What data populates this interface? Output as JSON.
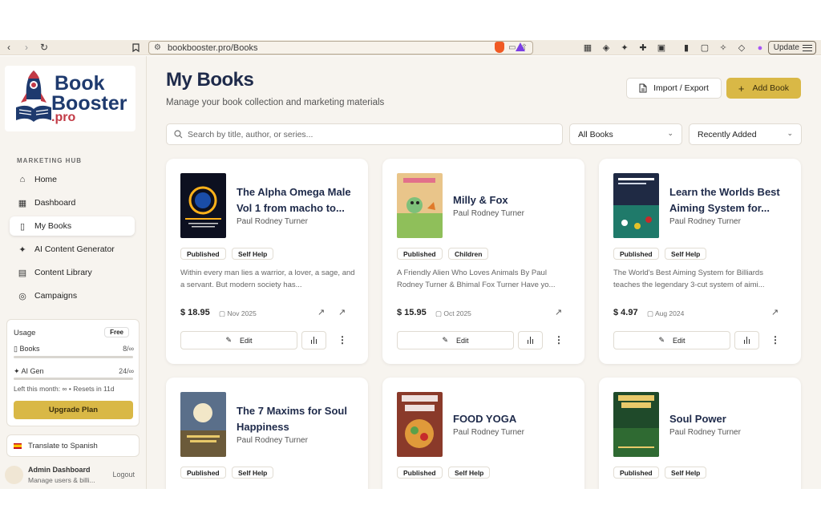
{
  "browser": {
    "url": "bookbooster.pro/Books",
    "update_label": "Update"
  },
  "sidebar": {
    "logo_line1": "Book",
    "logo_line2": "Booster",
    "logo_suffix": ".pro",
    "section_label": "MARKETING HUB",
    "items": [
      {
        "label": "Home",
        "icon": "home-icon"
      },
      {
        "label": "Dashboard",
        "icon": "grid-icon"
      },
      {
        "label": "My Books",
        "icon": "book-open-icon"
      },
      {
        "label": "AI Content Generator",
        "icon": "sparkles-icon"
      },
      {
        "label": "Content Library",
        "icon": "document-icon"
      },
      {
        "label": "Campaigns",
        "icon": "target-icon"
      }
    ],
    "usage": {
      "title": "Usage",
      "plan": "Free",
      "books_label": "Books",
      "books_value": "8/∞",
      "ai_label": "AI Gen",
      "ai_value": "24/∞",
      "reset_text": "Left this month: ∞ • Resets in 11d",
      "upgrade_label": "Upgrade Plan"
    },
    "translate_label": "Translate to Spanish",
    "admin": {
      "name": "Admin Dashboard",
      "subtitle": "Manage users & billi...",
      "logout_label": "Logout"
    }
  },
  "header": {
    "title": "My Books",
    "subtitle": "Manage your book collection and marketing materials",
    "import_label": "Import / Export",
    "add_label": "Add Book"
  },
  "filters": {
    "search_placeholder": "Search by title, author, or series...",
    "category": "All Books",
    "sort": "Recently Added"
  },
  "books": [
    {
      "title": "The Alpha Omega Male Vol 1 from macho to...",
      "author": "Paul Rodney Turner",
      "status": "Published",
      "category": "Self Help",
      "description": "Within every man lies a warrior, a lover, a sage, and a servant. But modern society has...",
      "price": "$ 18.95",
      "date": "Nov 2025"
    },
    {
      "title": "Milly & Fox",
      "author": "Paul Rodney Turner",
      "status": "Published",
      "category": "Children",
      "description": "A Friendly Alien Who Loves Animals By Paul Rodney Turner & Bhimal Fox Turner Have yo...",
      "price": "$ 15.95",
      "date": "Oct 2025"
    },
    {
      "title": "Learn the Worlds Best Aiming System for...",
      "author": "Paul Rodney Turner",
      "status": "Published",
      "category": "Self Help",
      "description": "The World's Best Aiming System for Billiards teaches the legendary 3-cut system of aimi...",
      "price": "$ 4.97",
      "date": "Aug 2024"
    },
    {
      "title": "The 7 Maxims for Soul Happiness",
      "author": "Paul Rodney Turner",
      "status": "Published",
      "category": "Self Help"
    },
    {
      "title": "FOOD YOGA",
      "author": "Paul Rodney Turner",
      "status": "Published",
      "category": "Self Help"
    },
    {
      "title": "Soul Power",
      "author": "Paul Rodney Turner",
      "status": "Published",
      "category": "Self Help"
    }
  ],
  "card_actions": {
    "edit_label": "Edit"
  },
  "colors": {
    "accent": "#d9b846",
    "title": "#1e2a4a",
    "background": "#f7f4ef"
  }
}
